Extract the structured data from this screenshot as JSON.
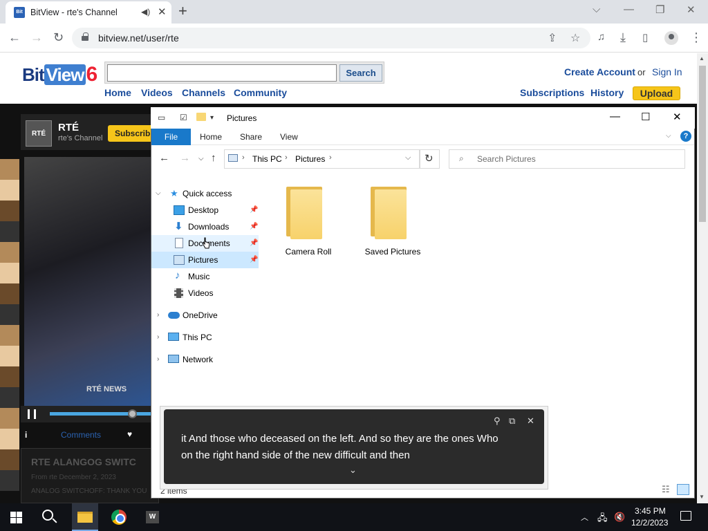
{
  "browser": {
    "tab_title": "BitView - rte's Channel",
    "favicon_text": "Bit",
    "url": "bitview.net/user/rte",
    "new_tab": "+",
    "close": "✕"
  },
  "site": {
    "logo_bit": "Bit",
    "logo_view": "View",
    "logo_six": "6",
    "search_button": "Search",
    "nav": [
      "Home",
      "Videos",
      "Channels",
      "Community"
    ],
    "create_account": "Create Account",
    "or": "or",
    "sign_in": "Sign In",
    "subscriptions": "Subscriptions",
    "history": "History",
    "upload": "Upload",
    "channel": {
      "badge": "RTÉ",
      "name": "RTÉ",
      "subtitle": "rte's Channel",
      "subscribe": "Subscrib"
    },
    "video_overlay": "RTÉ NEWS",
    "info_i": "i",
    "comments": "Comments",
    "below_title": "RTE ALANGOG SWITC",
    "below_meta": "From rte  December 2, 2023",
    "below_meta2": "ANALOG SWITCHOFF: THANK YOU"
  },
  "explorer": {
    "title": "Pictures",
    "ribbon": {
      "file": "File",
      "tabs": [
        "Home",
        "Share",
        "View"
      ],
      "help": "?"
    },
    "breadcrumb": [
      "This PC",
      "Pictures"
    ],
    "search_placeholder": "Search Pictures",
    "nav": {
      "quick_access": "Quick access",
      "items": [
        "Desktop",
        "Downloads",
        "Documents",
        "Pictures",
        "Music",
        "Videos"
      ],
      "onedrive": "OneDrive",
      "this_pc": "This PC",
      "network": "Network"
    },
    "folders": [
      "Camera Roll",
      "Saved Pictures"
    ],
    "status": "2 items"
  },
  "caption": {
    "line1": "it And those who deceased on the left. And so they are the ones Who",
    "line2": "on the right hand side of the new difficult and then"
  },
  "taskbar": {
    "word_label": "W",
    "time": "3:45 PM",
    "date": "12/2/2023"
  }
}
